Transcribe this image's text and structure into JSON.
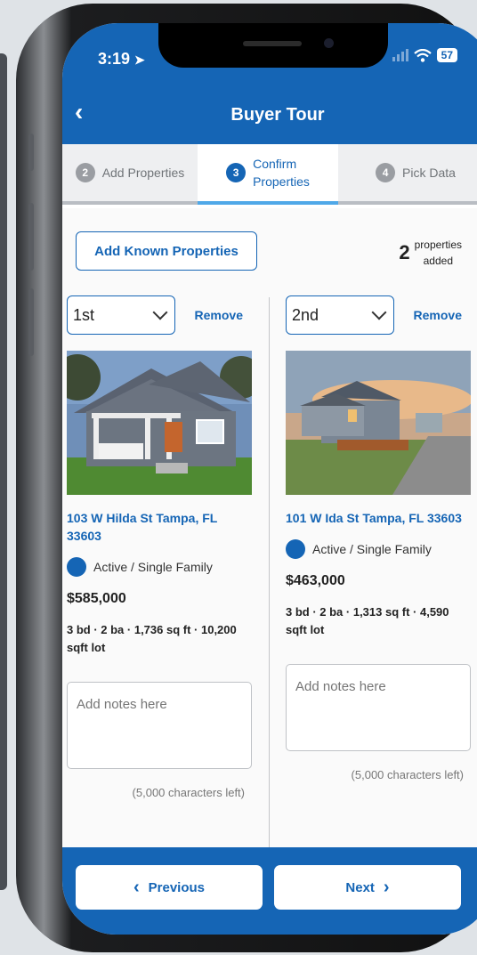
{
  "status_bar": {
    "time": "3:19",
    "battery": "57"
  },
  "header": {
    "title": "Buyer Tour"
  },
  "steps": [
    {
      "num": "2",
      "label": "Add Properties"
    },
    {
      "num": "3",
      "label_line1": "Confirm",
      "label_line2": "Properties"
    },
    {
      "num": "4",
      "label": "Pick Data"
    }
  ],
  "add_known_label": "Add Known Properties",
  "properties_added": {
    "count": "2",
    "label_line1": "properties",
    "label_line2": "added"
  },
  "properties": [
    {
      "rank": "1st",
      "remove_label": "Remove",
      "address": "103 W Hilda St Tampa, FL 33603",
      "status": "Active / Single Family",
      "price": "$585,000",
      "details": "3 bd · 2 ba · 1,736 sq ft · 10,200 sqft lot",
      "notes_placeholder": "Add notes here",
      "chars_left": "(5,000 characters left)"
    },
    {
      "rank": "2nd",
      "remove_label": "Remove",
      "address": "101 W Ida St Tampa, FL 33603",
      "status": "Active / Single Family",
      "price": "$463,000",
      "details": "3 bd · 2 ba · 1,313 sq ft · 4,590 sqft lot",
      "notes_placeholder": "Add notes here",
      "chars_left": "(5,000 characters left)"
    }
  ],
  "footer": {
    "previous_label": "Previous",
    "next_label": "Next"
  },
  "colors": {
    "accent": "#1565b5",
    "light_accent": "#4fa8e8"
  }
}
